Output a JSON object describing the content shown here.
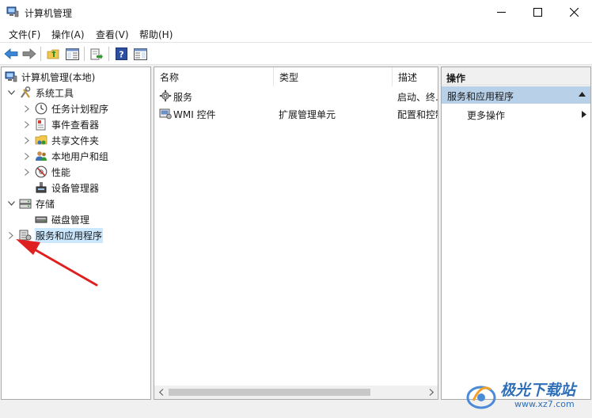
{
  "window": {
    "title": "计算机管理"
  },
  "menu": [
    "文件(F)",
    "操作(A)",
    "查看(V)",
    "帮助(H)"
  ],
  "toolbar": {
    "buttons": [
      "back-icon",
      "forward-icon",
      "up-folder-icon",
      "show-tree-icon",
      "export-list-icon",
      "help-icon",
      "show-action-pane-icon"
    ]
  },
  "tree": {
    "root": "计算机管理(本地)",
    "system_tools": "系统工具",
    "task_scheduler": "任务计划程序",
    "event_viewer": "事件查看器",
    "shared_folders": "共享文件夹",
    "local_users": "本地用户和组",
    "performance": "性能",
    "device_manager": "设备管理器",
    "storage": "存储",
    "disk_management": "磁盘管理",
    "services_apps": "服务和应用程序"
  },
  "list": {
    "columns": [
      "名称",
      "类型",
      "描述"
    ],
    "rows": [
      {
        "name": "服务",
        "type": "",
        "desc": "启动、终..."
      },
      {
        "name": "WMI 控件",
        "type": "扩展管理单元",
        "desc": "配置和控制..."
      }
    ]
  },
  "actions": {
    "header": "操作",
    "section": "服务和应用程序",
    "item": "更多操作"
  },
  "watermark": {
    "cn": "极光下载站",
    "url": "www.xz7.com"
  },
  "colors": {
    "selection": "#cce8ff",
    "actions_section": "#b8d1e9",
    "annotation_arrow": "#e02020"
  }
}
